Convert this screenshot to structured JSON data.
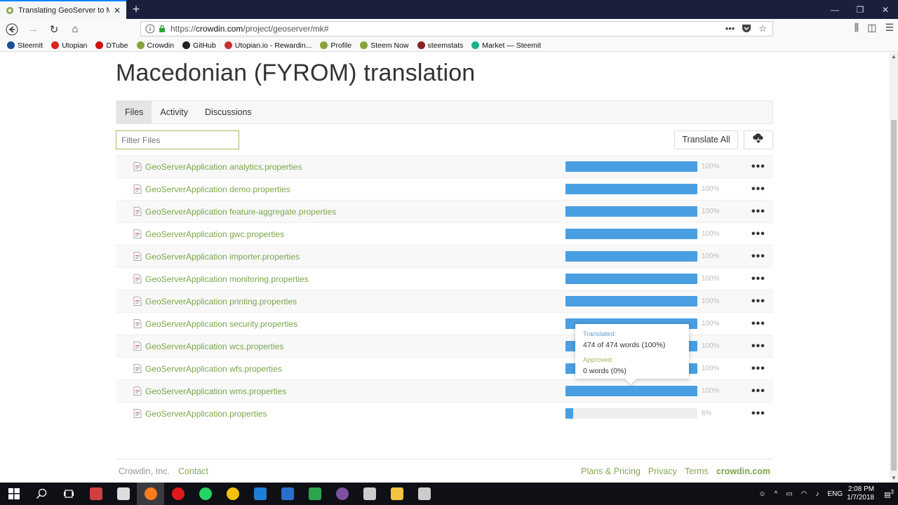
{
  "browser": {
    "tab_title": "Translating GeoServer to Macedonian",
    "url_prefix": "https://",
    "url_domain": "crowdin.com",
    "url_path": "/project/geoserver/mk#",
    "bookmarks": [
      {
        "label": "SteemIt",
        "color": "#1a5099"
      },
      {
        "label": "Utopian",
        "color": "#e02020"
      },
      {
        "label": "DTube",
        "color": "#cc1111"
      },
      {
        "label": "Crowdin",
        "color": "#8aa33a"
      },
      {
        "label": "GitHub",
        "color": "#222222"
      },
      {
        "label": "Utopian.io - Rewardin...",
        "color": "#c93030"
      },
      {
        "label": "Profile",
        "color": "#8aa33a"
      },
      {
        "label": "Steem Now",
        "color": "#8aa33a"
      },
      {
        "label": "steemstats",
        "color": "#882222"
      },
      {
        "label": "Market — Steemit",
        "color": "#1ab08c"
      }
    ]
  },
  "page": {
    "title": "Macedonian (FYROM) translation",
    "tabs": [
      "Files",
      "Activity",
      "Discussions"
    ],
    "filter_placeholder": "Filter Files",
    "translate_all_label": "Translate All",
    "files": [
      {
        "name": "GeoServerApplication analytics.properties",
        "progress": 100,
        "pct_label": "100%"
      },
      {
        "name": "GeoServerApplication demo.properties",
        "progress": 100,
        "pct_label": "100%"
      },
      {
        "name": "GeoServerApplication feature-aggregate.properties",
        "progress": 100,
        "pct_label": "100%"
      },
      {
        "name": "GeoServerApplication gwc.properties",
        "progress": 100,
        "pct_label": "100%"
      },
      {
        "name": "GeoServerApplication importer.properties",
        "progress": 100,
        "pct_label": "100%"
      },
      {
        "name": "GeoServerApplication monitoring.properties",
        "progress": 100,
        "pct_label": "100%"
      },
      {
        "name": "GeoServerApplication printing.properties",
        "progress": 100,
        "pct_label": "100%"
      },
      {
        "name": "GeoServerApplication security.properties",
        "progress": 100,
        "pct_label": "100%"
      },
      {
        "name": "GeoServerApplication wcs.properties",
        "progress": 100,
        "pct_label": "100%"
      },
      {
        "name": "GeoServerApplication wfs.properties",
        "progress": 100,
        "pct_label": "100%"
      },
      {
        "name": "GeoServerApplication wms.properties",
        "progress": 100,
        "pct_label": "100%"
      },
      {
        "name": "GeoServerApplication.properties",
        "progress": 6,
        "pct_label": "6%"
      }
    ],
    "tooltip": {
      "translated_label": "Translated:",
      "translated_value": "474 of 474 words (100%)",
      "approved_label": "Approved:",
      "approved_value": "0 words (0%)"
    },
    "footer": {
      "left": [
        "Crowdin, Inc.",
        "Contact"
      ],
      "right": [
        "Plans & Pricing",
        "Privacy",
        "Terms"
      ],
      "brand": "crowdin.com"
    }
  },
  "taskbar": {
    "apps": [
      {
        "name": "Unknown app",
        "color": "#d04040"
      },
      {
        "name": "Mail",
        "color": "#dddddd"
      },
      {
        "name": "Firefox",
        "color": "#ff7b1a"
      },
      {
        "name": "Opera",
        "color": "#e01a1a"
      },
      {
        "name": "WhatsApp",
        "color": "#25d366"
      },
      {
        "name": "Chrome",
        "color": "#f4c20d"
      },
      {
        "name": "Edge",
        "color": "#1e7fd6"
      },
      {
        "name": "Unknown app",
        "color": "#2a6fd0"
      },
      {
        "name": "Unknown app",
        "color": "#2ea44f"
      },
      {
        "name": "Viber",
        "color": "#7b519d"
      },
      {
        "name": "Unknown app",
        "color": "#cccccc"
      },
      {
        "name": "File Explorer",
        "color": "#f5c342"
      },
      {
        "name": "Unknown app",
        "color": "#cccccc"
      }
    ],
    "language": "ENG",
    "time": "2:08 PM",
    "date": "1/7/2018",
    "notification_count": "3"
  },
  "colors": {
    "link_green": "#7aa64a",
    "progress_blue": "#4a9fe2"
  }
}
